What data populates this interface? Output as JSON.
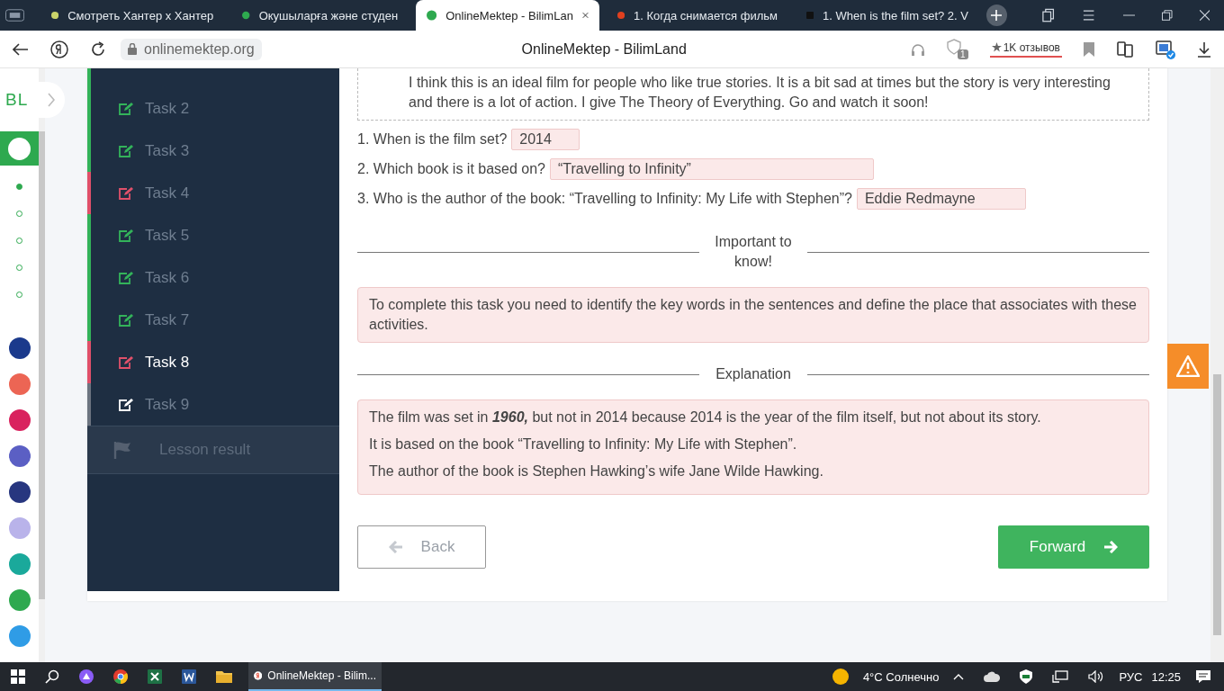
{
  "browser": {
    "tabs": [
      {
        "title": "Смотреть Хантер х Хантер",
        "selected": false
      },
      {
        "title": "Окушыларға және студен",
        "selected": false
      },
      {
        "title": "OnlineMektep - BilimLan",
        "selected": true
      },
      {
        "title": "1. Когда снимается фильм",
        "selected": false
      },
      {
        "title": "1. When is the film set? 2. V",
        "selected": false
      }
    ],
    "url": "onlinemektep.org",
    "page_title": "OnlineMektep - BilimLand",
    "extension_badge": "1",
    "reviews": "1K отзывов"
  },
  "rail": {
    "logo": "BL",
    "steps": [
      {
        "selected": true
      },
      {
        "selected": false
      },
      {
        "selected": false
      },
      {
        "selected": false
      },
      {
        "selected": false
      }
    ],
    "apps": [
      {
        "color": "#1b3a8c"
      },
      {
        "color": "#ec6554"
      },
      {
        "color": "#d9225e"
      },
      {
        "color": "#5b5fc4"
      },
      {
        "color": "#27367f"
      },
      {
        "color": "#b9b3ea"
      },
      {
        "color": "#1aa99b"
      },
      {
        "color": "#2ea94f"
      },
      {
        "color": "#2f9ce6"
      }
    ]
  },
  "tasks": [
    {
      "label": "Task 2",
      "color": "#33b35a",
      "selected": false
    },
    {
      "label": "Task 3",
      "color": "#33b35a",
      "selected": false
    },
    {
      "label": "Task 4",
      "color": "#e0506a",
      "selected": false
    },
    {
      "label": "Task 5",
      "color": "#33b35a",
      "selected": false
    },
    {
      "label": "Task 6",
      "color": "#33b35a",
      "selected": false
    },
    {
      "label": "Task 7",
      "color": "#33b35a",
      "selected": false
    },
    {
      "label": "Task 8",
      "color": "#e0506a",
      "selected": true
    },
    {
      "label": "Task 9",
      "color": "#6c7480",
      "selected": false
    }
  ],
  "lesson_result": "Lesson result",
  "text_paragraph": "I think this is an ideal film for people who like true stories. It is a bit sad at times but the story is very interesting and there is a lot of action. I give The Theory of Everything. Go and watch it soon!",
  "questions": [
    {
      "prompt": "1. When is the film set?",
      "value": "2014"
    },
    {
      "prompt": "2. Which book is it based on?",
      "value": "“Travelling to Infinity”"
    },
    {
      "prompt": "3. Who is the author of the book: “Travelling to Infinity: My Life with Stephen”?",
      "value": "Eddie Redmayne"
    }
  ],
  "important": {
    "heading": "Important to know!",
    "text": "To complete this task you need to identify the key words in the sentences and define the place that associates with these activities."
  },
  "explanation": {
    "heading": "Explanation",
    "lines": [
      "The film was set in **1960,** but not in 2014 because 2014 is the year of the film itself, but not about its story.",
      "It is based on the book “Travelling to Infinity: My Life with Stephen”.",
      "The author of the book is Stephen Hawking’s wife Jane Wilde Hawking."
    ]
  },
  "buttons": {
    "back": "Back",
    "forward": "Forward"
  },
  "taskbar": {
    "active_app": "OnlineMektep - Bilim...",
    "weather": "4°C Солнечно",
    "language": "РУС",
    "time": "12:25"
  }
}
